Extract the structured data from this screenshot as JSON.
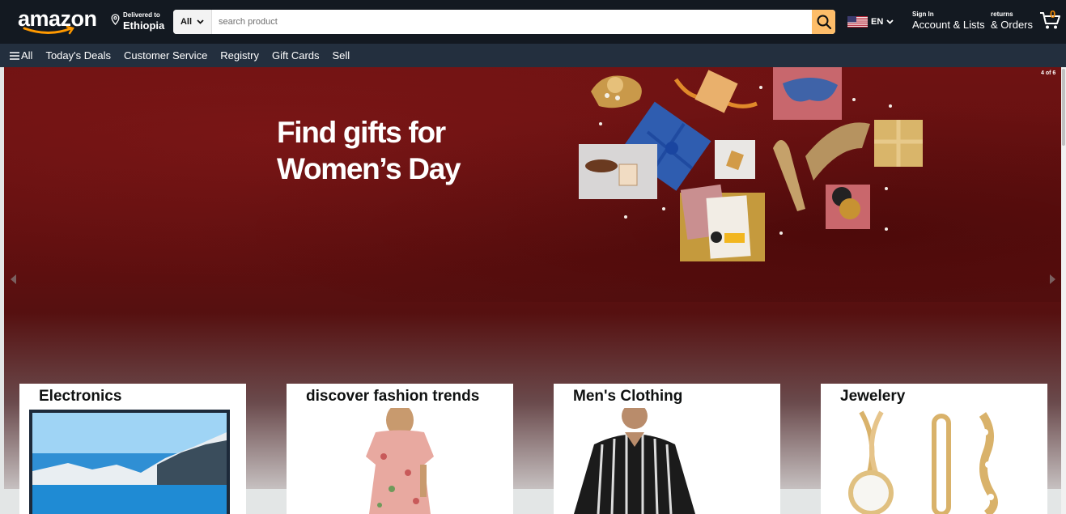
{
  "header": {
    "logo_text": "amazon",
    "deliver_to_label": "Delivered to",
    "deliver_to_location": "Ethiopia",
    "search": {
      "category": "All",
      "placeholder": "search product"
    },
    "language": "EN",
    "account": {
      "line1": "Sign In",
      "line2": "Account & Lists"
    },
    "orders": {
      "line1": "returns",
      "line2": "& Orders"
    },
    "cart_count": "0",
    "colors": {
      "bg": "#131921",
      "accent": "#febd69",
      "cart": "#f08804"
    }
  },
  "subnav": {
    "all_label": "All",
    "links": [
      "Today's Deals",
      "Customer Service",
      "Registry",
      "Gift Cards",
      "Sell"
    ]
  },
  "hero": {
    "title_line1": "Find gifts for",
    "title_line2": "Women’s Day",
    "counter": "4 of 6"
  },
  "cards": [
    {
      "title": "Electronics"
    },
    {
      "title": "discover fashion trends"
    },
    {
      "title": "Men's Clothing"
    },
    {
      "title": "Jewelery"
    }
  ]
}
